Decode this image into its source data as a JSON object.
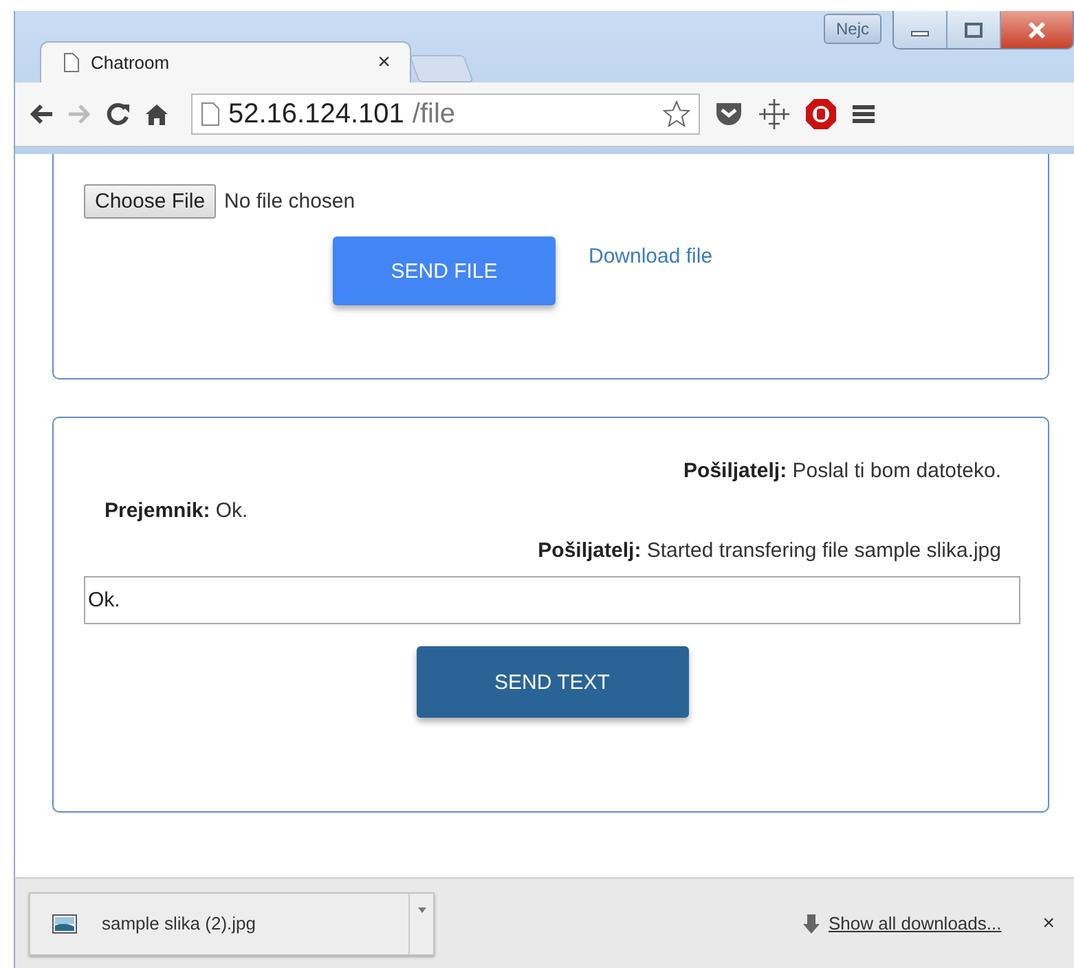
{
  "window": {
    "user_badge": "Nejc",
    "tabs": [
      {
        "title": "Chatroom",
        "close": "×",
        "selected": true
      }
    ],
    "address": {
      "host": "52.16.124.101",
      "path": "/file"
    }
  },
  "file_card": {
    "choose_button": "Choose File",
    "file_status": "No file chosen",
    "send_button": "SEND FILE",
    "download_link": "Download file"
  },
  "chat_card": {
    "messages": [
      {
        "kind": "outgoing",
        "author": "Pošiljatelj:",
        "text": "Poslal ti bom datoteko."
      },
      {
        "kind": "incoming",
        "author": "Prejemnik:",
        "text": "Ok."
      },
      {
        "kind": "outgoing",
        "author": "Pošiljatelj:",
        "text": "Started transfering file sample slika.jpg"
      }
    ],
    "input": {
      "value": "Ok."
    },
    "send_button": "SEND TEXT"
  },
  "download_bar": {
    "file": "sample slika (2).jpg",
    "show_all": "Show all downloads...",
    "close": "×"
  }
}
